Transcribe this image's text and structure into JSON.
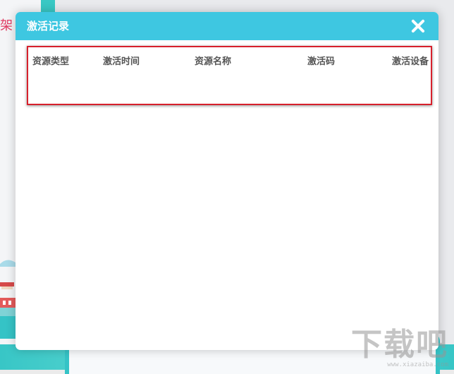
{
  "background": {
    "left_label": "架"
  },
  "dialog": {
    "title": "激活记录",
    "columns": [
      "资源类型",
      "激活时间",
      "资源名称",
      "激活码",
      "激活设备"
    ],
    "header_color": "#3ec7e1",
    "highlight_color": "#d7202c"
  },
  "watermark": {
    "text": "下载吧",
    "url": "www.xiazaiba.com"
  }
}
